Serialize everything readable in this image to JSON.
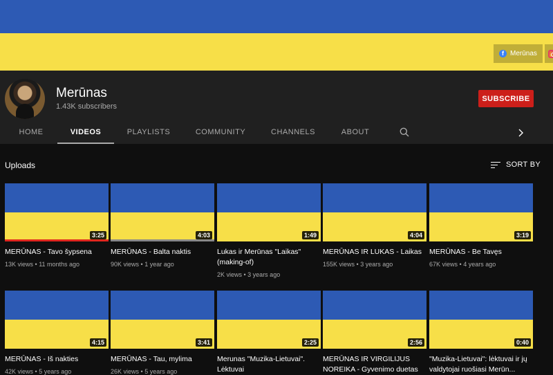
{
  "banner": {
    "colors": {
      "top": "#2d5ab4",
      "bottom": "#f7df48"
    },
    "links": [
      {
        "label": "Merūnas",
        "icon": "facebook-icon"
      },
      {
        "label": "",
        "icon": "instagram-icon"
      }
    ]
  },
  "channel": {
    "name": "Merūnas",
    "subscribers": "1.43K subscribers",
    "subscribe_label": "SUBSCRIBE"
  },
  "tabs": [
    {
      "label": "HOME"
    },
    {
      "label": "VIDEOS",
      "active": true
    },
    {
      "label": "PLAYLISTS"
    },
    {
      "label": "COMMUNITY"
    },
    {
      "label": "CHANNELS"
    },
    {
      "label": "ABOUT"
    }
  ],
  "section": {
    "title": "Uploads",
    "sort_label": "SORT BY"
  },
  "videos": [
    {
      "title": "MERŪNAS - Tavo šypsena",
      "duration": "3:25",
      "views": "13K views",
      "age": "11 months ago",
      "watched": 1.0
    },
    {
      "title": "MERŪNAS - Balta naktis",
      "duration": "4:03",
      "views": "90K views",
      "age": "1 year ago",
      "watched": 1.0
    },
    {
      "title": "Lukas ir Merūnas \"Laikas\" (making-of)",
      "duration": "1:49",
      "views": "2K views",
      "age": "3 years ago"
    },
    {
      "title": "MERŪNAS IR LUKAS - Laikas",
      "duration": "4:04",
      "views": "155K views",
      "age": "3 years ago"
    },
    {
      "title": "MERŪNAS - Be Tavęs",
      "duration": "3:19",
      "views": "67K views",
      "age": "4 years ago"
    },
    {
      "title": "MERŪNAS - Iš nakties",
      "duration": "4:15",
      "views": "42K views",
      "age": "5 years ago"
    },
    {
      "title": "MERŪNAS - Tau, mylima",
      "duration": "3:41",
      "views": "26K views",
      "age": "5 years ago"
    },
    {
      "title": "Merunas \"Muzika-Lietuvai\". Lėktuvai",
      "duration": "2:25",
      "views": "",
      "age": ""
    },
    {
      "title": "MERŪNAS IR VIRGILIJUS NOREIKA - Gyvenimo duetas",
      "duration": "2:56",
      "views": "",
      "age": ""
    },
    {
      "title": "\"Muzika-Lietuvai\": lėktuvai ir jų valdytojai ruošiasi Merūn...",
      "duration": "0:40",
      "views": "",
      "age": ""
    }
  ]
}
